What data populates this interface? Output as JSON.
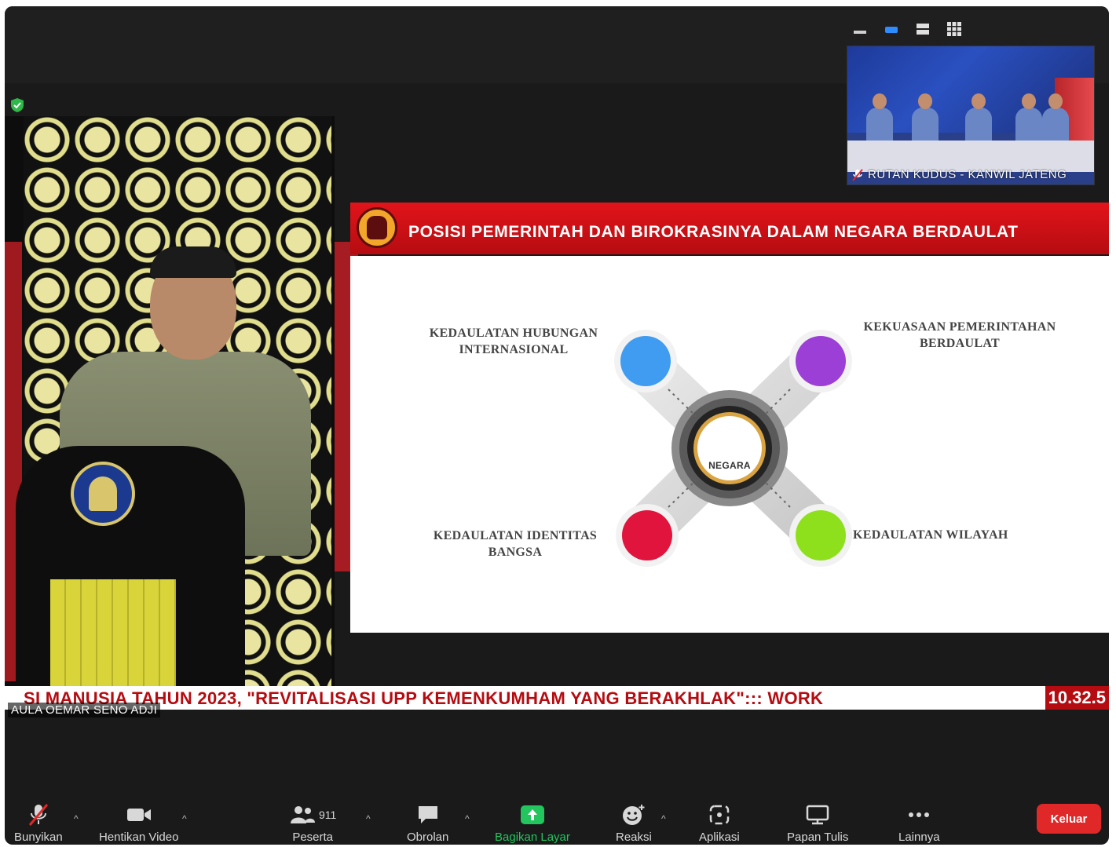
{
  "view_controls": [
    "minimize-view",
    "speaker-view",
    "stacked-view",
    "gallery-view"
  ],
  "thumbnail": {
    "participant_name": "RUTAN KUDUS - KANWIL JATENG"
  },
  "speaker": {
    "participant_name": "AULA OEMAR SENO ADJI"
  },
  "slide": {
    "title": "POSISI PEMERINTAH DAN BIROKRASINYA DALAM NEGARA BERDAULAT",
    "center_label": "NEGARA",
    "nodes": {
      "top_left": {
        "label_line1": "KEDAULATAN HUBUNGAN",
        "label_line2": "INTERNASIONAL",
        "color": "#3f9cf0"
      },
      "top_right": {
        "label_line1": "KEKUASAAN PEMERINTAHAN",
        "label_line2": "BERDAULAT",
        "color": "#9b3fd6"
      },
      "bottom_left": {
        "label_line1": "KEDAULATAN IDENTITAS",
        "label_line2": "BANGSA",
        "color": "#e0143c"
      },
      "bottom_right": {
        "label_line1": "KEDAULATAN WILAYAH",
        "label_line2": "",
        "color": "#8ee01c"
      }
    }
  },
  "ticker": {
    "text": "SI MANUSIA TAHUN 2023, \"REVITALISASI UPP KEMENKUMHAM YANG BERAKHLAK\"::: WORK",
    "time": "10.32.5"
  },
  "toolbar": {
    "mute_label": "Bunyikan",
    "video_label": "Hentikan Video",
    "participants_label": "Peserta",
    "participants_count": "911",
    "chat_label": "Obrolan",
    "share_label": "Bagikan Layar",
    "reactions_label": "Reaksi",
    "apps_label": "Aplikasi",
    "whiteboard_label": "Papan Tulis",
    "more_label": "Lainnya",
    "leave_label": "Keluar"
  },
  "colors": {
    "share_active": "#22c55e",
    "leave": "#e02828",
    "slide_header": "#d5121a"
  }
}
